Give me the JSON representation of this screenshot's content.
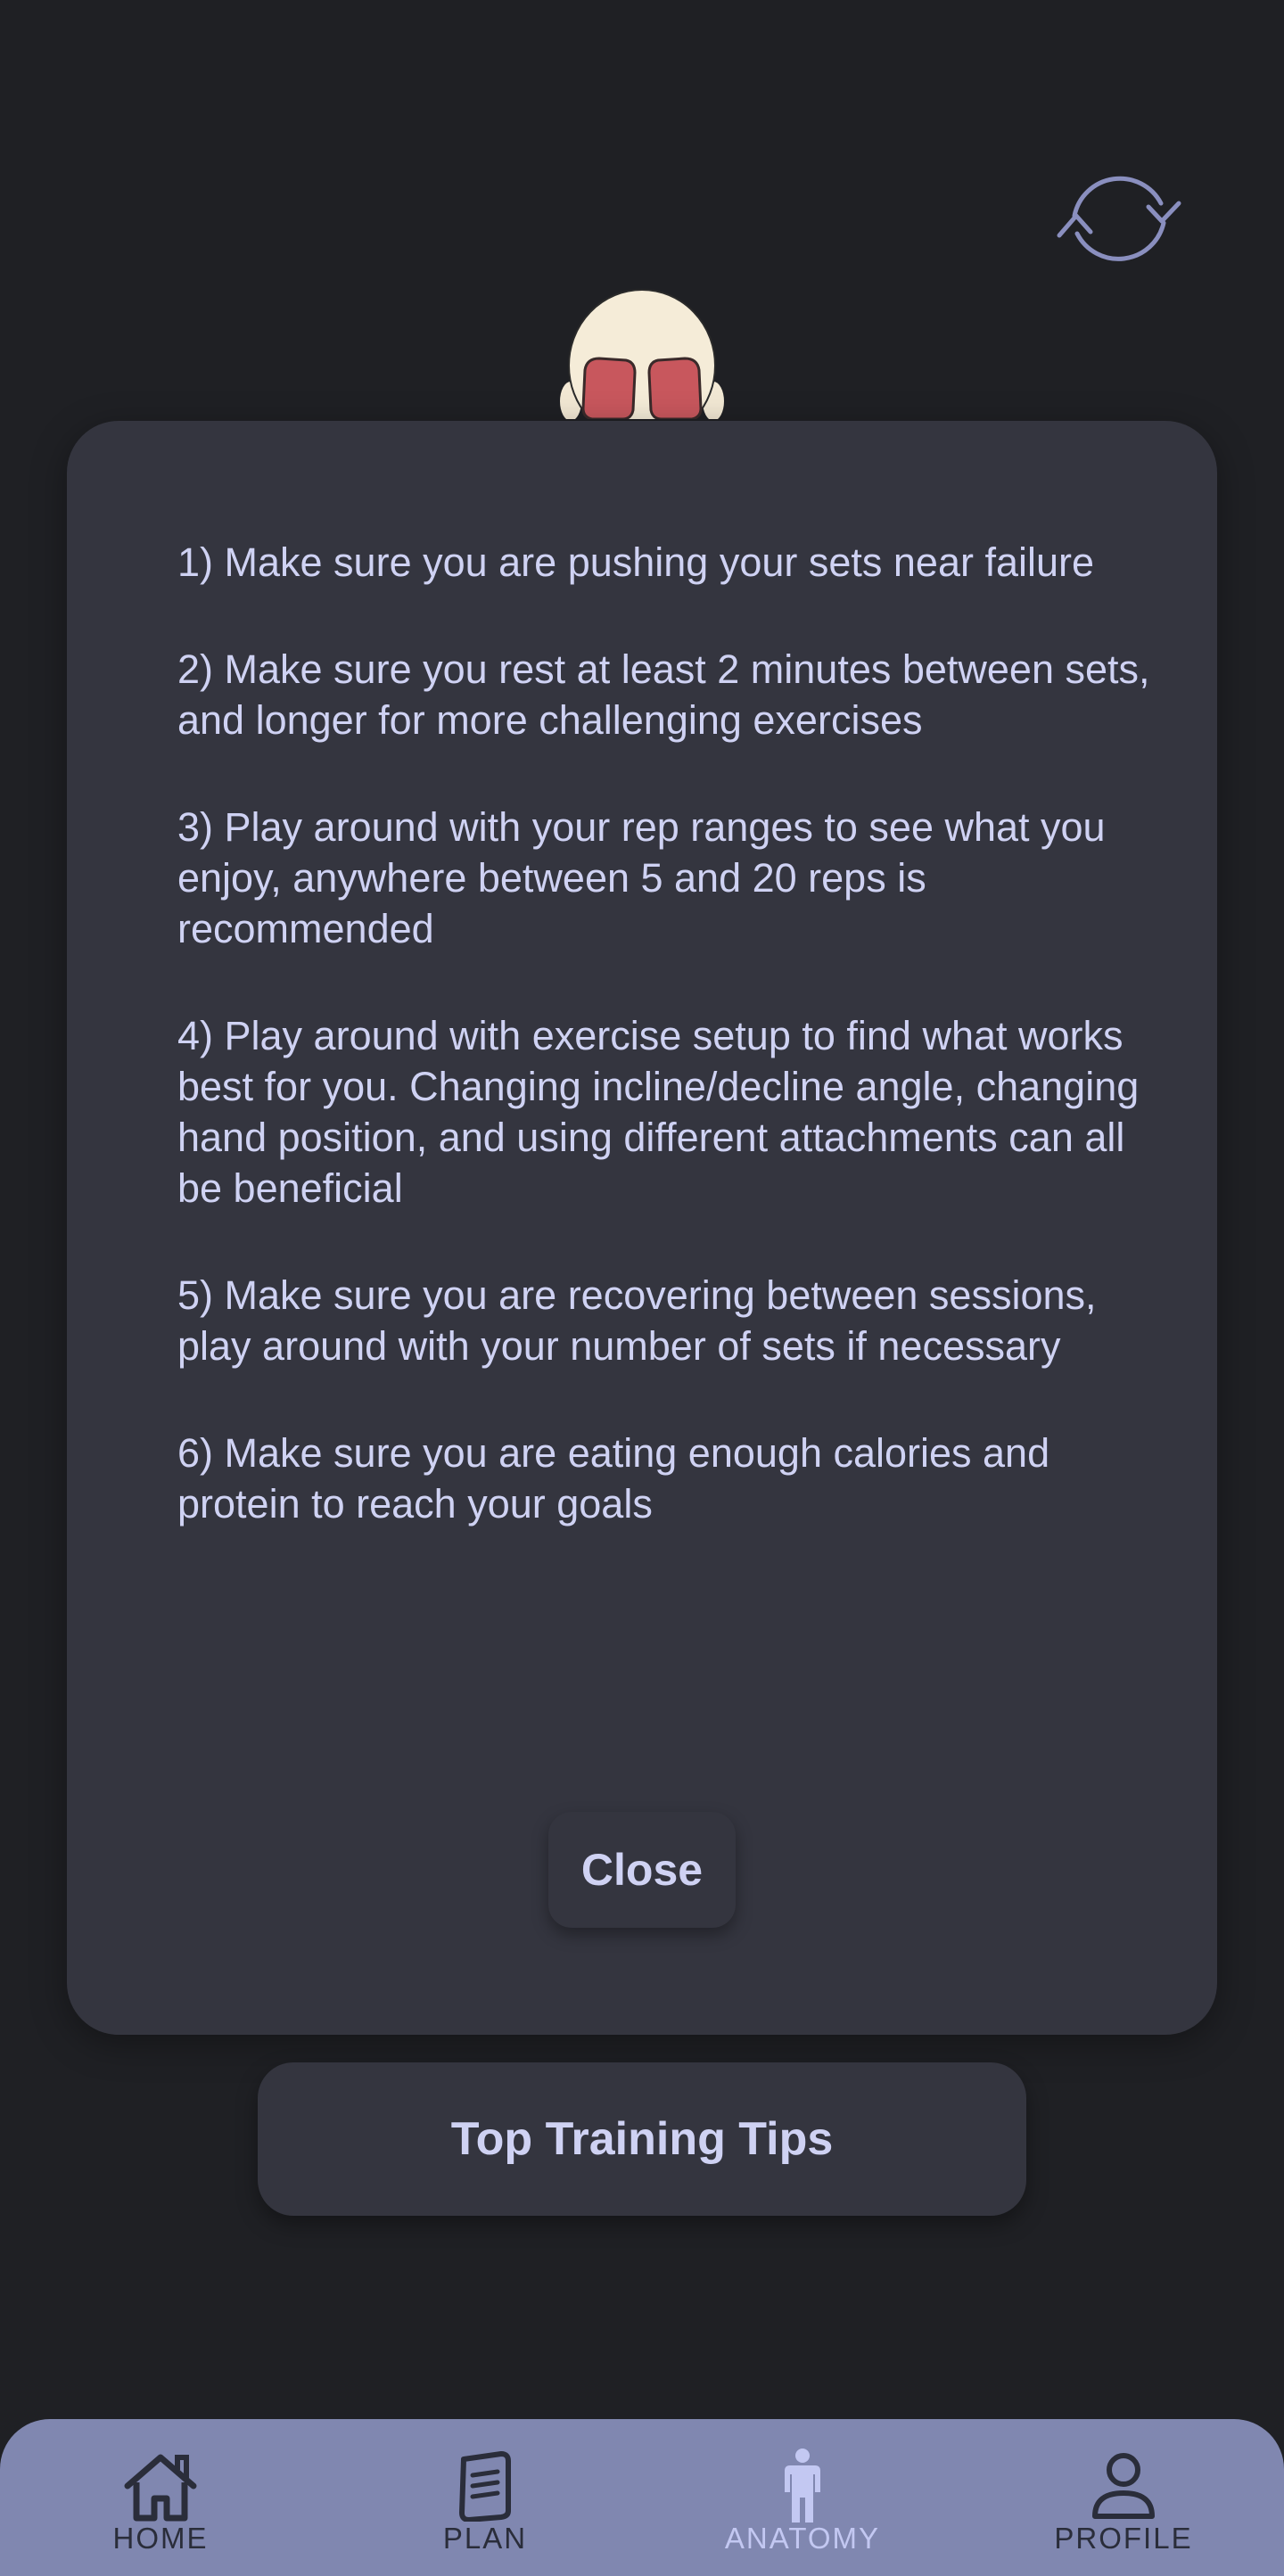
{
  "tips_dialog": {
    "tips": [
      "1) Make sure you are pushing your sets near failure",
      "2) Make sure you rest at least 2 minutes between sets, and longer for more challenging exercises",
      "3) Play around with your rep ranges to see what you enjoy, anywhere between 5 and 20 reps is recommended",
      "4) Play around with exercise setup to find what works best for you. Changing incline/decline angle, changing hand position, and using different attachments can all be beneficial",
      "5) Make sure you are recovering between sessions, play around with your number of sets if necessary",
      "6) Make sure you are eating enough calories and protein to reach your goals"
    ],
    "close_label": "Close"
  },
  "top_tips_label": "Top Training Tips",
  "icons": {
    "refresh": "refresh-icon",
    "figure": "anatomy-figure"
  },
  "nav": {
    "items": [
      {
        "label": "HOME",
        "icon": "home-icon"
      },
      {
        "label": "PLAN",
        "icon": "plan-icon"
      },
      {
        "label": "ANATOMY",
        "icon": "anatomy-icon",
        "active": true
      },
      {
        "label": "PROFILE",
        "icon": "profile-icon"
      }
    ]
  },
  "colors": {
    "background": "#1f2024",
    "card": "#34353f",
    "text": "#cfd2f3",
    "navbar": "#8087b0",
    "nav_active": "#c3c8f2",
    "muscle": "#c8575d"
  }
}
